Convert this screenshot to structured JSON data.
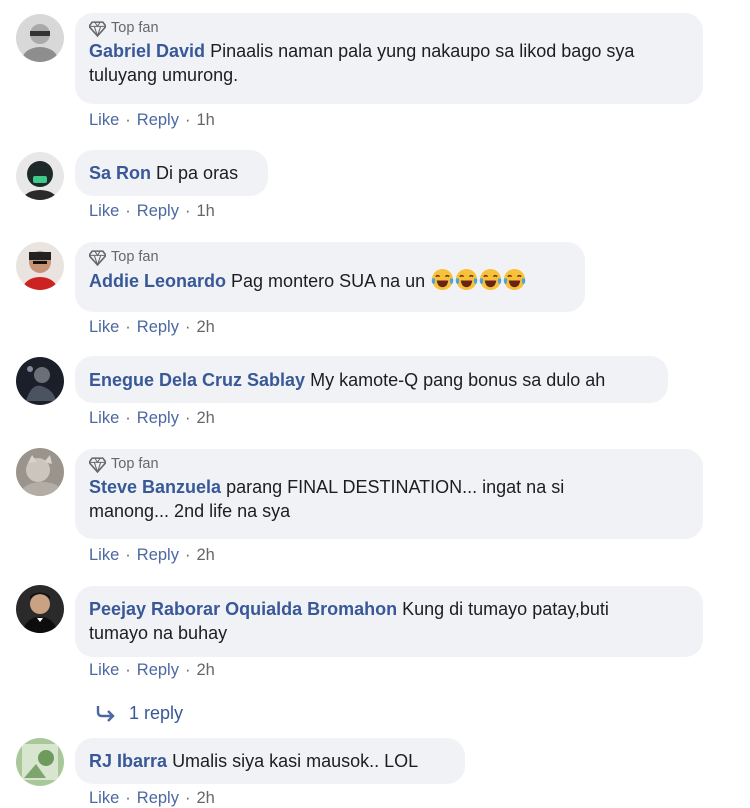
{
  "comments": [
    {
      "author": "Gabriel David",
      "text": "Pinaalis naman pala yung nakaupo sa likod bago sya",
      "text2": "tuluyang umurong.",
      "badge": "Top fan",
      "like": "Like",
      "reply": "Reply",
      "time": "1h"
    },
    {
      "author": "Sa Ron",
      "text": "Di pa oras",
      "like": "Like",
      "reply": "Reply",
      "time": "1h"
    },
    {
      "author": "Addie Leonardo",
      "text": "Pag montero SUA na un",
      "badge": "Top fan",
      "like": "Like",
      "reply": "Reply",
      "time": "2h"
    },
    {
      "author": "Enegue Dela Cruz Sablay",
      "text": "My kamote-Q pang bonus sa dulo ah",
      "like": "Like",
      "reply": "Reply",
      "time": "2h"
    },
    {
      "author": "Steve Banzuela",
      "text": "parang FINAL DESTINATION... ingat na si",
      "text2": "manong... 2nd life na sya",
      "badge": "Top fan",
      "like": "Like",
      "reply": "Reply",
      "time": "2h"
    },
    {
      "author": "Peejay Raborar Oquialda Bromahon",
      "text": "Kung di tumayo patay,buti",
      "text2": "tumayo na buhay",
      "like": "Like",
      "reply": "Reply",
      "time": "2h"
    },
    {
      "author": "RJ Ibarra",
      "text": "Umalis siya kasi mausok.. LOL",
      "like": "Like",
      "reply": "Reply",
      "time": "2h"
    }
  ],
  "replies_toggle": "1 reply",
  "icons": {
    "badge": "diamond-icon",
    "emoji": "laughing-tears-emoji-icon",
    "reply_arrow": "reply-arrow-icon"
  },
  "colors": {
    "author": "#385898",
    "bubble": "#f0f2f5",
    "meta": "#65676b"
  }
}
